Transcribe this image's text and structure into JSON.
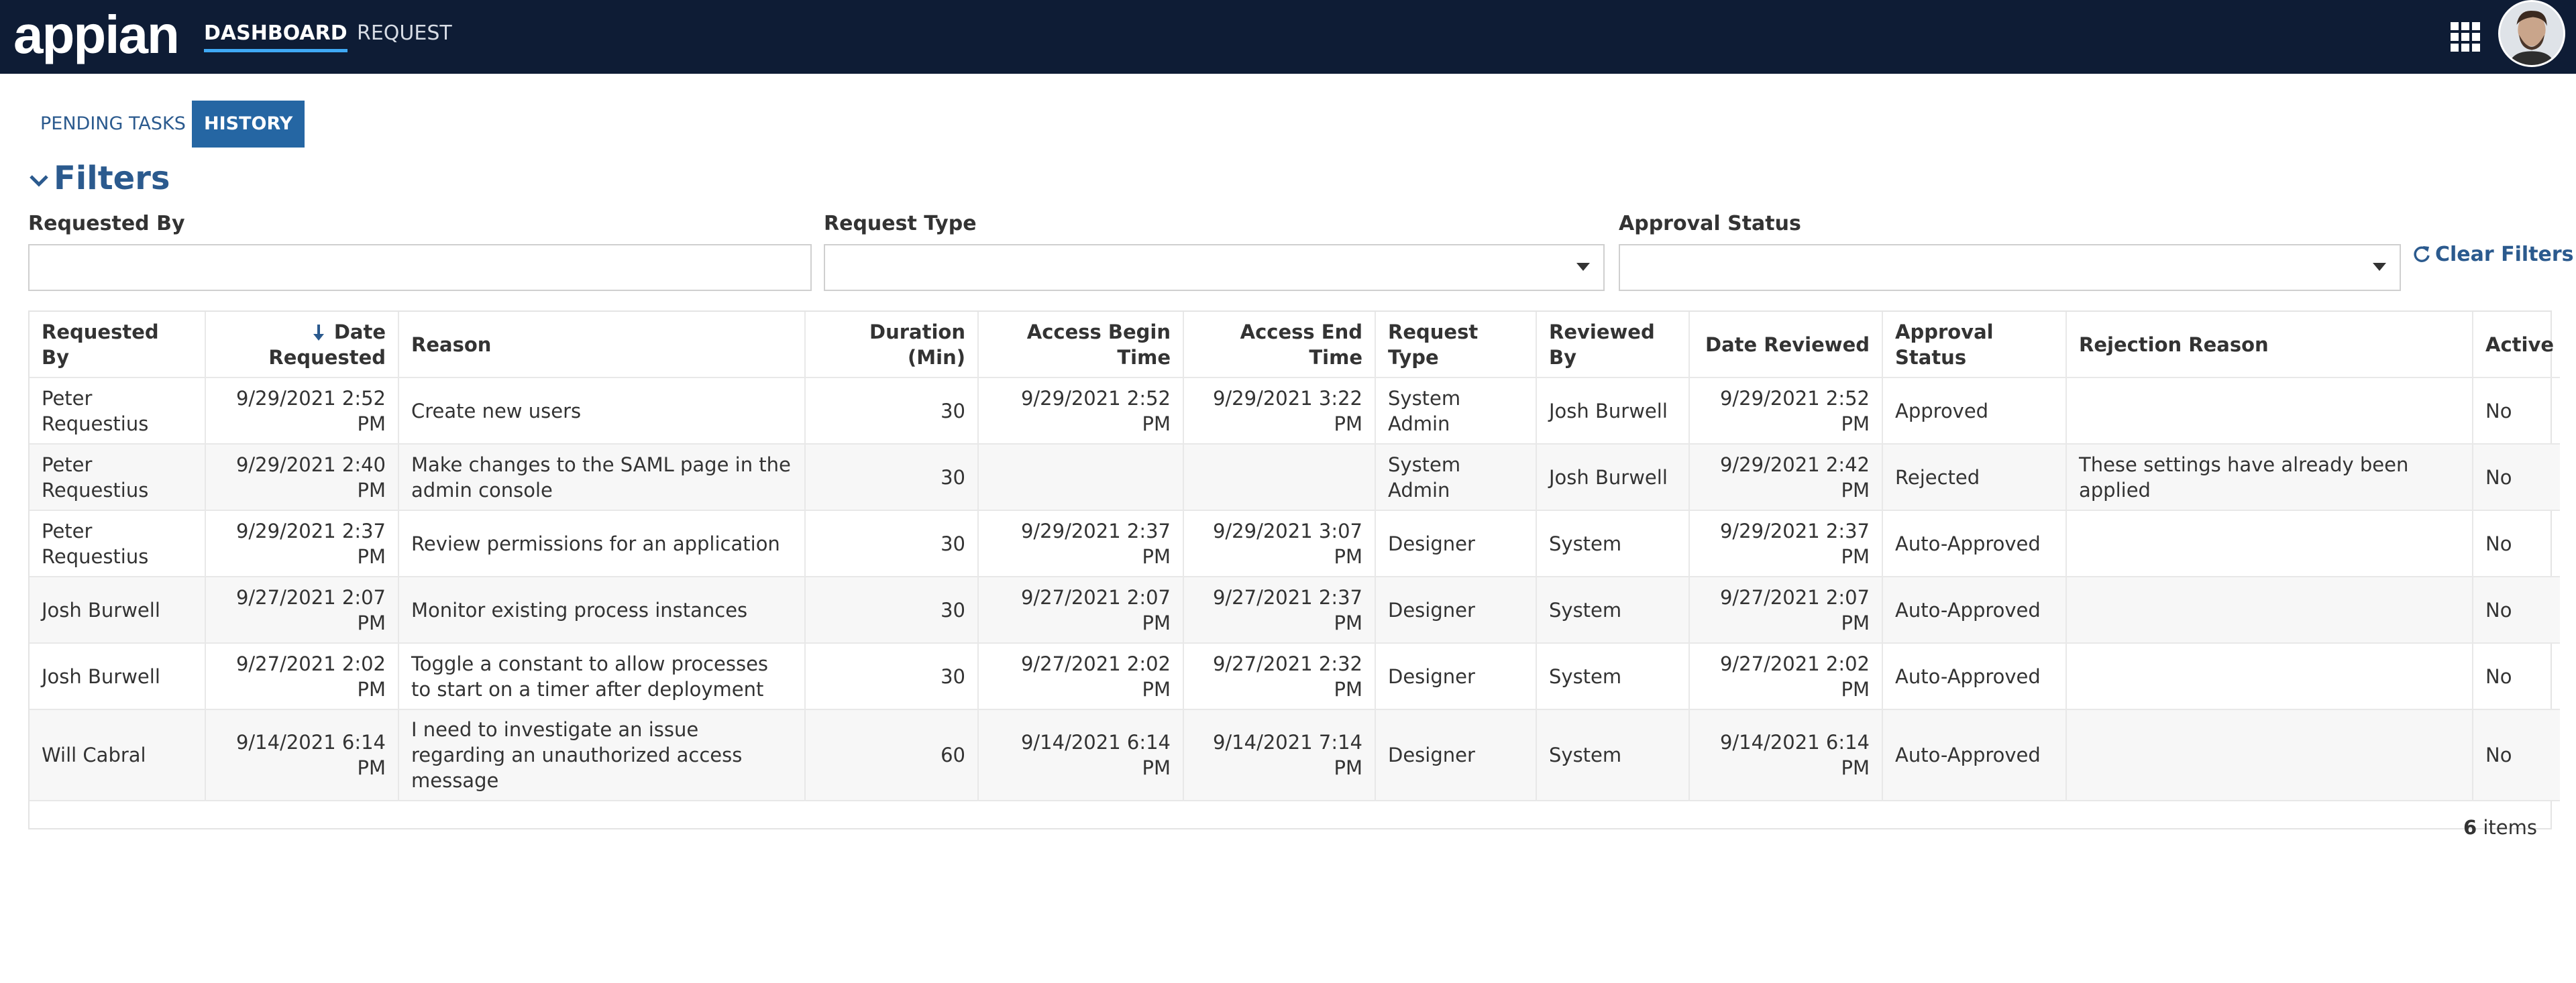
{
  "app": {
    "logo_text": "appian",
    "nav": [
      {
        "label": "DASHBOARD",
        "active": true
      },
      {
        "label": "REQUEST",
        "active": false
      }
    ],
    "icons": {
      "apps": "grid-icon",
      "user": "avatar"
    },
    "colors": {
      "header_bg": "#0e1c35",
      "accent": "#2566a3",
      "nav_underline": "#3fa9f5",
      "link": "#2b5a8e"
    }
  },
  "tabs": [
    {
      "label": "PENDING TASKS",
      "active": false
    },
    {
      "label": "HISTORY",
      "active": true
    }
  ],
  "filters": {
    "title": "Filters",
    "requested_by": {
      "label": "Requested By",
      "value": ""
    },
    "request_type": {
      "label": "Request Type",
      "value": ""
    },
    "approval_status": {
      "label": "Approval Status",
      "value": ""
    },
    "clear_label": "Clear Filters"
  },
  "grid": {
    "columns": [
      "Requested By",
      "Date Requested",
      "Reason",
      "Duration (Min)",
      "Access Begin Time",
      "Access End Time",
      "Request Type",
      "Reviewed By",
      "Date Reviewed",
      "Approval Status",
      "Rejection Reason",
      "Active"
    ],
    "sorted_column": "Date Requested",
    "sort_direction": "descending",
    "rows": [
      [
        "Peter Requestius",
        "9/29/2021 2:52 PM",
        "Create new users",
        "30",
        "9/29/2021 2:52 PM",
        "9/29/2021 3:22 PM",
        "System Admin",
        "Josh Burwell",
        "9/29/2021 2:52 PM",
        "Approved",
        "",
        "No"
      ],
      [
        "Peter Requestius",
        "9/29/2021 2:40 PM",
        "Make changes to the SAML page in the admin console",
        "30",
        "",
        "",
        "System Admin",
        "Josh Burwell",
        "9/29/2021 2:42 PM",
        "Rejected",
        "These settings have already been applied",
        "No"
      ],
      [
        "Peter Requestius",
        "9/29/2021 2:37 PM",
        "Review permissions for an application",
        "30",
        "9/29/2021 2:37 PM",
        "9/29/2021 3:07 PM",
        "Designer",
        "System",
        "9/29/2021 2:37 PM",
        "Auto-Approved",
        "",
        "No"
      ],
      [
        "Josh Burwell",
        "9/27/2021 2:07 PM",
        "Monitor existing process instances",
        "30",
        "9/27/2021 2:07 PM",
        "9/27/2021 2:37 PM",
        "Designer",
        "System",
        "9/27/2021 2:07 PM",
        "Auto-Approved",
        "",
        "No"
      ],
      [
        "Josh Burwell",
        "9/27/2021 2:02 PM",
        "Toggle a constant to allow processes to start on a timer after deployment",
        "30",
        "9/27/2021 2:02 PM",
        "9/27/2021 2:32 PM",
        "Designer",
        "System",
        "9/27/2021 2:02 PM",
        "Auto-Approved",
        "",
        "No"
      ],
      [
        "Will Cabral",
        "9/14/2021 6:14 PM",
        "I need to investigate an issue regarding an unauthorized access message",
        "60",
        "9/14/2021 6:14 PM",
        "9/14/2021 7:14 PM",
        "Designer",
        "System",
        "9/14/2021 6:14 PM",
        "Auto-Approved",
        "",
        "No"
      ]
    ],
    "items_count": "6",
    "items_label": "items"
  }
}
